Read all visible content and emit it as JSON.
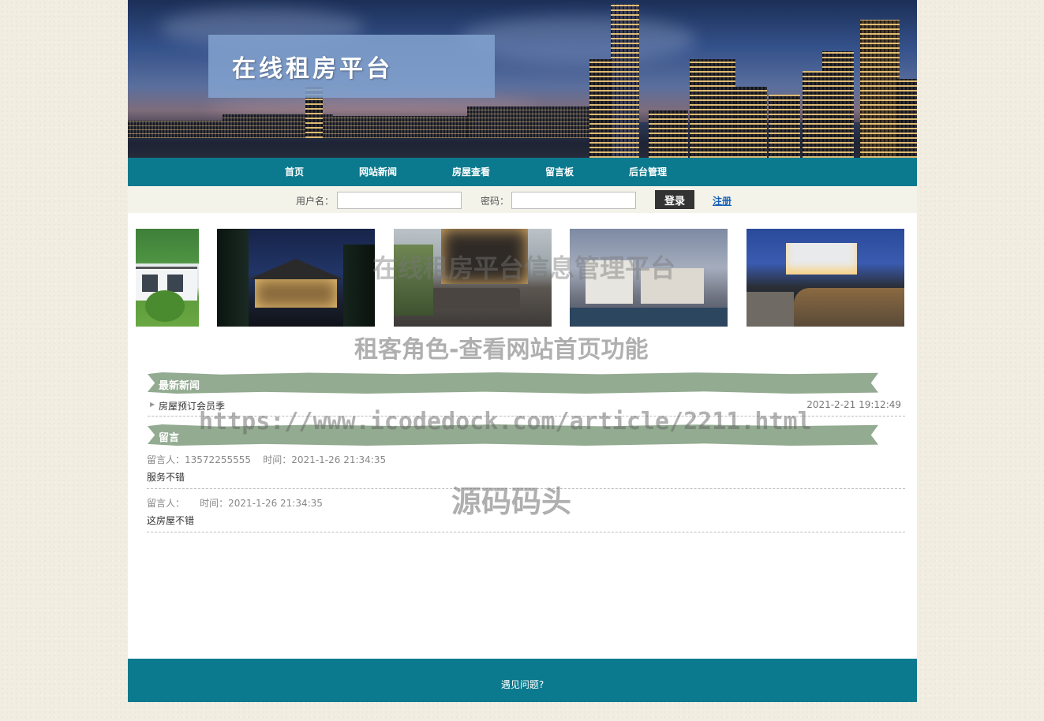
{
  "header": {
    "site_title": "在线租房平台"
  },
  "nav": {
    "items": [
      {
        "label": "首页"
      },
      {
        "label": "网站新闻"
      },
      {
        "label": "房屋查看"
      },
      {
        "label": "留言板"
      },
      {
        "label": "后台管理"
      }
    ]
  },
  "login": {
    "username_label": "用户名：",
    "username_value": "",
    "password_label": "密码：",
    "password_value": "",
    "login_button": "登录",
    "register_link": "注册"
  },
  "gallery": {
    "photos": [
      {
        "subject": "house-on-hill"
      },
      {
        "subject": "chinese-courtyard-night"
      },
      {
        "subject": "terrace-lounge"
      },
      {
        "subject": "white-villa-dusk"
      },
      {
        "subject": "stone-wall-path-villa"
      }
    ]
  },
  "watermarks": {
    "line1": "在线租房平台信息管理平台",
    "line2": "租客角色-查看网站首页功能",
    "line3": "https://www.icodedock.com/article/2211.html",
    "line4": "源码码头"
  },
  "news": {
    "heading": "最新新闻",
    "items": [
      {
        "title": "房屋预订会员季",
        "date": "2021-2-21 19:12:49"
      }
    ]
  },
  "messages": {
    "heading": "留言",
    "items": [
      {
        "author_label": "留言人：",
        "author": "13572255555",
        "time_label": "时间：",
        "time": "2021-1-26 21:34:35",
        "content": "服务不错"
      },
      {
        "author_label": "留言人：",
        "author": "",
        "time_label": "时间：",
        "time": "2021-1-26 21:34:35",
        "content": "这房屋不错"
      }
    ]
  },
  "footer": {
    "text": "遇见问题?"
  },
  "colors": {
    "nav_bg": "#0b7a8e",
    "section_head": "#93ab91",
    "page_bg": "#f1ede0",
    "title_box": "#82a0cd"
  }
}
